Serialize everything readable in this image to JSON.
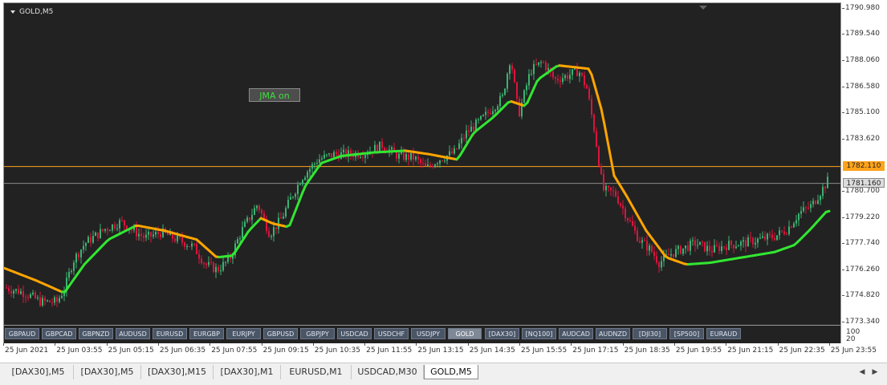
{
  "chart": {
    "title": "GOLD,M5",
    "indicator_label": "JMA on"
  },
  "price_axis": {
    "labels": [
      "1790.980",
      "1789.540",
      "1788.060",
      "1786.580",
      "1785.100",
      "1783.620",
      "1780.700",
      "1779.220",
      "1777.740",
      "1776.260",
      "1774.820",
      "1773.340"
    ],
    "bid_label": "1782.110",
    "ask_label": "1781.160"
  },
  "volume_axis": {
    "max": "100",
    "min": "20"
  },
  "time_axis": {
    "labels": [
      "25 Jun 2021",
      "25 Jun 03:55",
      "25 Jun 05:15",
      "25 Jun 06:35",
      "25 Jun 07:55",
      "25 Jun 09:15",
      "25 Jun 10:35",
      "25 Jun 11:55",
      "25 Jun 13:15",
      "25 Jun 14:35",
      "25 Jun 15:55",
      "25 Jun 17:15",
      "25 Jun 18:35",
      "25 Jun 19:55",
      "25 Jun 21:15",
      "25 Jun 22:35",
      "25 Jun 23:55"
    ]
  },
  "symbol_buttons": [
    "GBPAUD",
    "GBPCAD",
    "GBPNZD",
    "AUDUSD",
    "EURUSD",
    "EURGBP",
    "EURJPY",
    "GBPUSD",
    "GBPJPY",
    "USDCAD",
    "USDCHF",
    "USDJPY",
    "GOLD",
    "[DAX30]",
    "[NQ100]",
    "AUDCAD",
    "AUDNZD",
    "[DJI30]",
    "[SP500]",
    "EURAUD"
  ],
  "active_symbol": "GOLD",
  "tabs": [
    "[DAX30],M5",
    "[DAX30],M5",
    "[DAX30],M15",
    "[DAX30],M1",
    "EURUSD,M1",
    "USDCAD,M30",
    "GOLD,M5"
  ],
  "active_tab": "GOLD,M5",
  "colors": {
    "background": "#222222",
    "bull": "#3cb371",
    "bear": "#dc143c",
    "jma_up": "#32e632",
    "jma_down": "#ffa500",
    "bid_line": "#ffa31a",
    "ask_line": "#8c8c8c"
  },
  "chart_data": {
    "type": "candlestick",
    "symbol": "GOLD",
    "timeframe": "M5",
    "ylim": [
      1773.34,
      1790.98
    ],
    "bid": 1782.11,
    "ask": 1781.16,
    "close_path": [
      [
        0,
        1775.3
      ],
      [
        25,
        1775.0
      ],
      [
        45,
        1774.5
      ],
      [
        65,
        1774.5
      ],
      [
        75,
        1775.3
      ],
      [
        85,
        1776.8
      ],
      [
        100,
        1777.8
      ],
      [
        125,
        1778.6
      ],
      [
        145,
        1779.0
      ],
      [
        160,
        1778.5
      ],
      [
        175,
        1778.1
      ],
      [
        195,
        1778.4
      ],
      [
        215,
        1778.0
      ],
      [
        235,
        1777.6
      ],
      [
        250,
        1776.6
      ],
      [
        265,
        1776.3
      ],
      [
        280,
        1776.9
      ],
      [
        295,
        1778.5
      ],
      [
        315,
        1780.0
      ],
      [
        330,
        1778.3
      ],
      [
        345,
        1779.2
      ],
      [
        355,
        1780.2
      ],
      [
        370,
        1781.5
      ],
      [
        390,
        1782.5
      ],
      [
        410,
        1782.8
      ],
      [
        430,
        1782.8
      ],
      [
        450,
        1782.9
      ],
      [
        470,
        1783.3
      ],
      [
        490,
        1782.7
      ],
      [
        510,
        1782.6
      ],
      [
        525,
        1782.0
      ],
      [
        540,
        1782.5
      ],
      [
        560,
        1782.9
      ],
      [
        575,
        1784.0
      ],
      [
        595,
        1784.8
      ],
      [
        620,
        1786.0
      ],
      [
        630,
        1788.3
      ],
      [
        640,
        1785.0
      ],
      [
        655,
        1787.5
      ],
      [
        670,
        1788.0
      ],
      [
        685,
        1787.0
      ],
      [
        700,
        1787.2
      ],
      [
        715,
        1787.5
      ],
      [
        725,
        1786.5
      ],
      [
        735,
        1784.0
      ],
      [
        745,
        1780.8
      ],
      [
        760,
        1780.6
      ],
      [
        775,
        1779.3
      ],
      [
        790,
        1778.0
      ],
      [
        805,
        1777.4
      ],
      [
        815,
        1776.7
      ],
      [
        830,
        1777.2
      ],
      [
        845,
        1777.5
      ],
      [
        860,
        1777.8
      ],
      [
        880,
        1777.4
      ],
      [
        900,
        1777.7
      ],
      [
        920,
        1777.8
      ],
      [
        940,
        1778.0
      ],
      [
        960,
        1778.2
      ],
      [
        975,
        1778.6
      ],
      [
        990,
        1779.5
      ],
      [
        1005,
        1779.9
      ],
      [
        1025,
        1781.3
      ]
    ],
    "jma_path": [
      [
        0,
        1776.4
      ],
      [
        40,
        1775.7
      ],
      [
        75,
        1775.0
      ],
      [
        100,
        1776.6
      ],
      [
        130,
        1778.0
      ],
      [
        165,
        1778.8
      ],
      [
        200,
        1778.5
      ],
      [
        240,
        1778.0
      ],
      [
        265,
        1777.0
      ],
      [
        285,
        1777.1
      ],
      [
        305,
        1778.5
      ],
      [
        320,
        1779.2
      ],
      [
        335,
        1778.9
      ],
      [
        355,
        1778.7
      ],
      [
        375,
        1781.0
      ],
      [
        395,
        1782.3
      ],
      [
        420,
        1782.7
      ],
      [
        460,
        1782.9
      ],
      [
        500,
        1783.0
      ],
      [
        530,
        1782.8
      ],
      [
        565,
        1782.5
      ],
      [
        585,
        1784.0
      ],
      [
        610,
        1784.9
      ],
      [
        630,
        1785.8
      ],
      [
        650,
        1785.5
      ],
      [
        665,
        1787.0
      ],
      [
        690,
        1787.8
      ],
      [
        730,
        1787.6
      ],
      [
        745,
        1785.2
      ],
      [
        760,
        1781.6
      ],
      [
        775,
        1780.5
      ],
      [
        800,
        1778.5
      ],
      [
        825,
        1777.0
      ],
      [
        850,
        1776.6
      ],
      [
        880,
        1776.7
      ],
      [
        920,
        1777.0
      ],
      [
        960,
        1777.3
      ],
      [
        985,
        1777.7
      ],
      [
        1005,
        1778.6
      ],
      [
        1025,
        1779.6
      ]
    ]
  }
}
